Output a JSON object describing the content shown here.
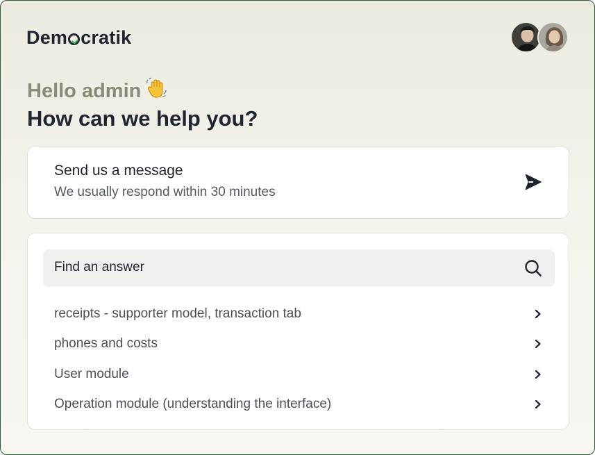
{
  "brand": {
    "pre": "Dem",
    "post": "cratik"
  },
  "greeting": {
    "text": "Hello admin",
    "emoji": "👋"
  },
  "headline": "How can we help you?",
  "message_card": {
    "title": "Send us a message",
    "subtitle": "We usually respond within 30 minutes",
    "icon": "send-icon"
  },
  "help": {
    "search_label": "Find an answer",
    "search_icon": "search-icon",
    "articles": [
      {
        "label": "receipts - supporter model, transaction tab"
      },
      {
        "label": "phones and costs"
      },
      {
        "label": "User module"
      },
      {
        "label": "Operation module (understanding the interface)"
      }
    ]
  },
  "colors": {
    "brand_text": "#1f2430",
    "brand_check": "#2db34a",
    "greeting": "#8b8b78",
    "frame_border": "#2f5a3a"
  }
}
